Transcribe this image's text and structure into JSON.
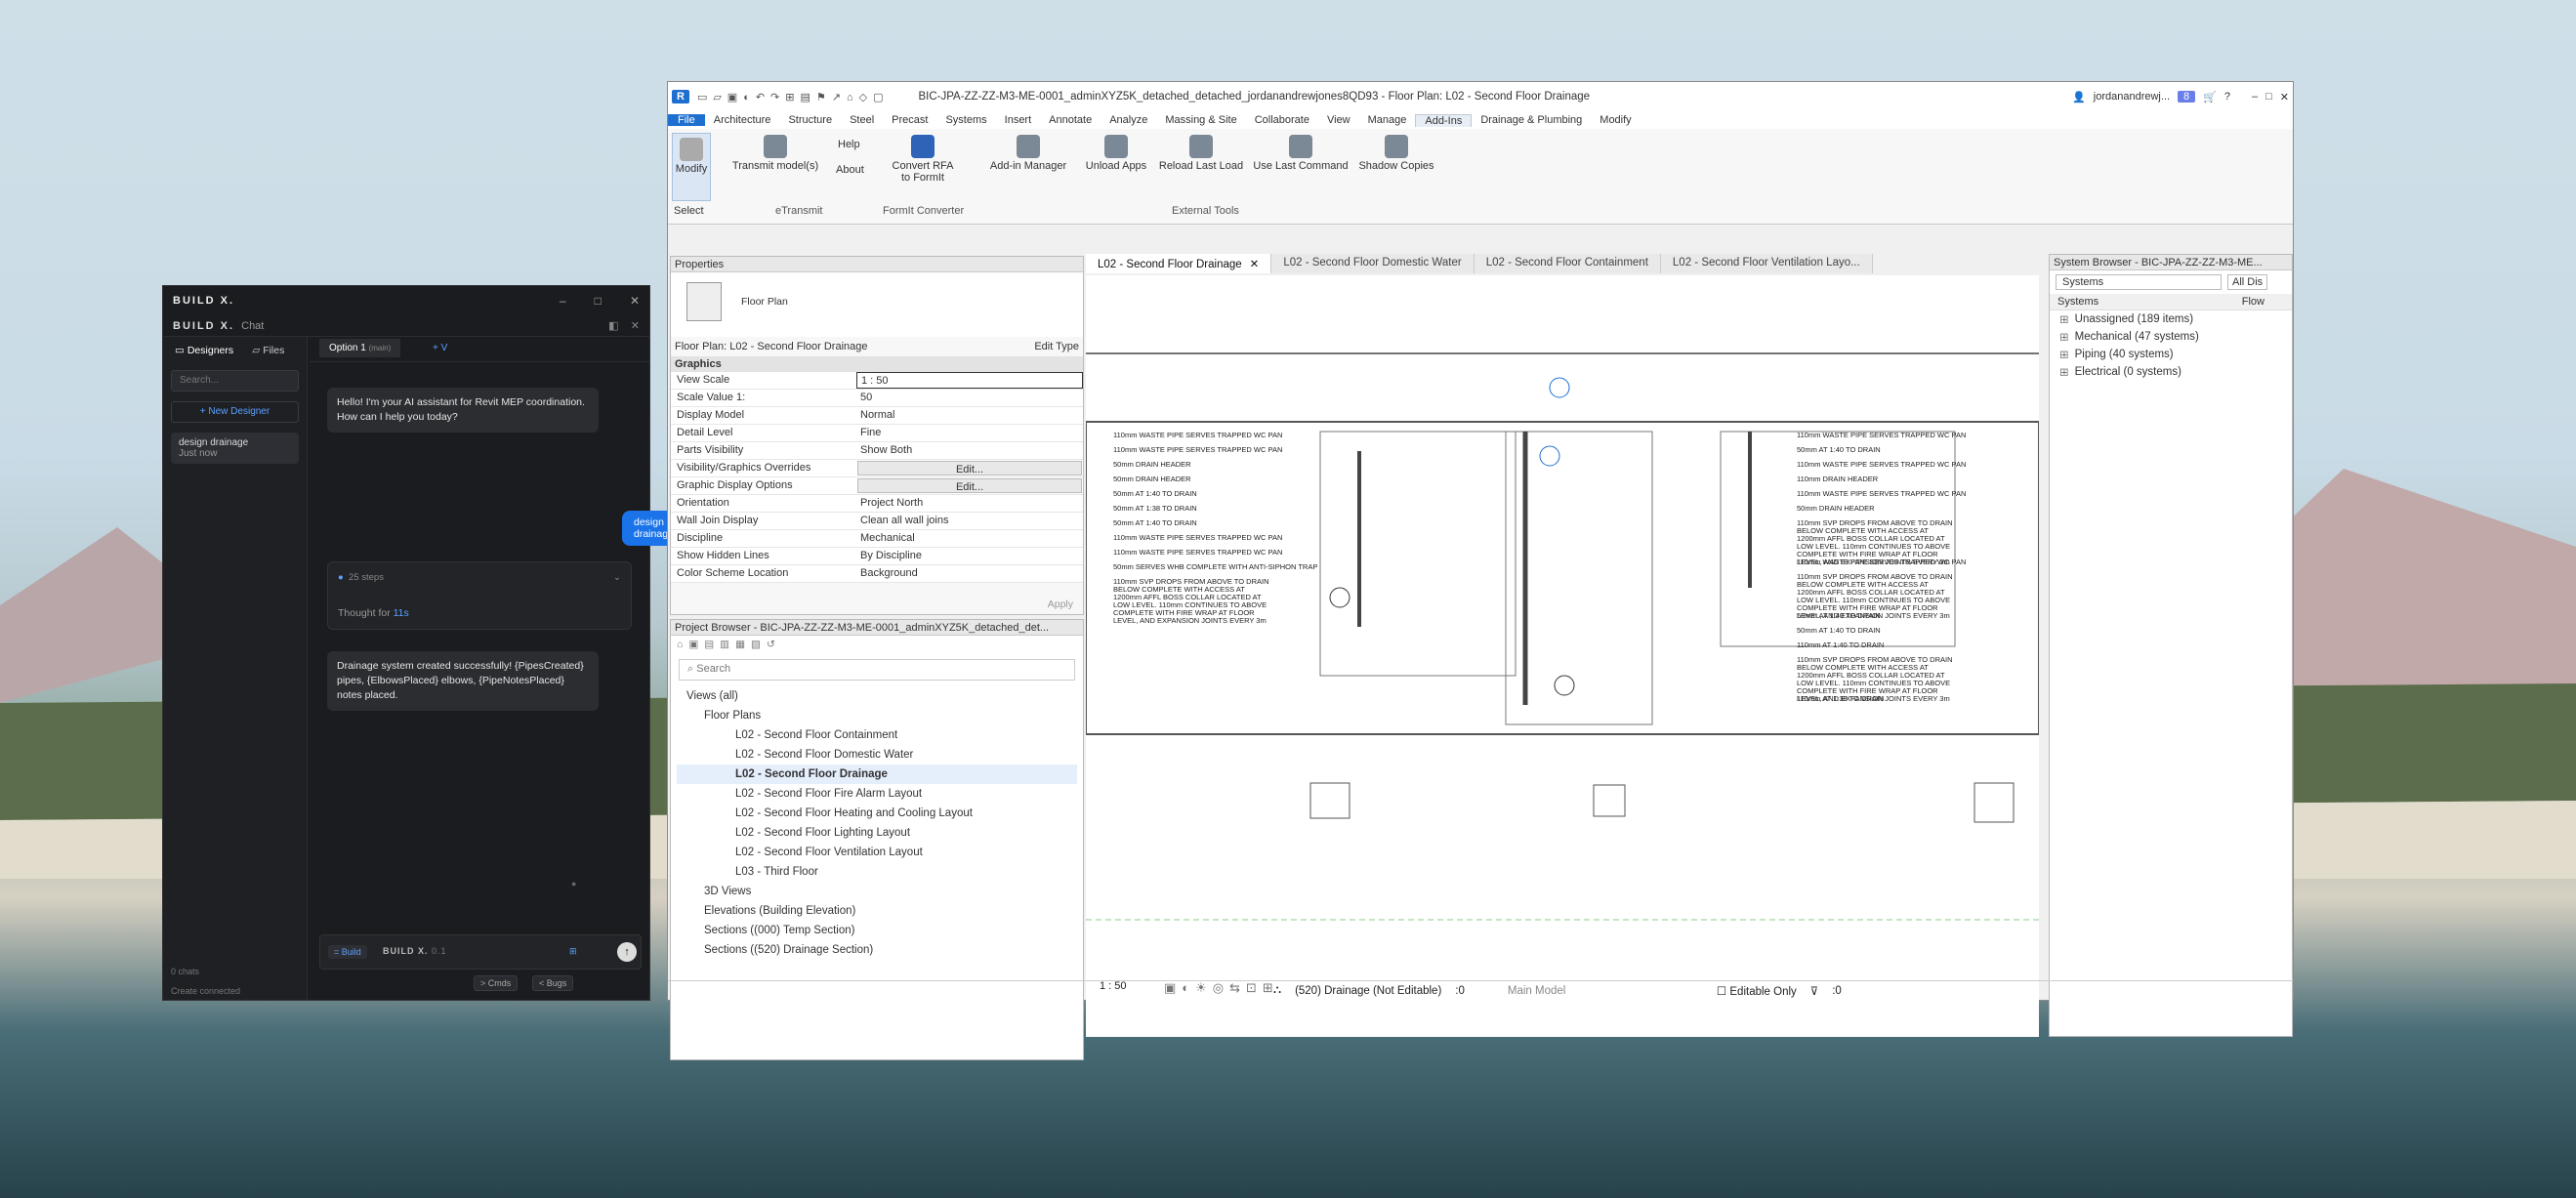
{
  "build_window": {
    "logo": "BUILD X.",
    "header_logo": "BUILD X.",
    "header_chat": "Chat",
    "min": "–",
    "max": "□",
    "close": "✕",
    "panel_close": "✕",
    "sidebar": {
      "tab_designers": "Designers",
      "tab_files": "Files",
      "search_placeholder": "Search...",
      "new_designer": "+ New Designer",
      "history": [
        {
          "title": "design drainage",
          "time": "Just now"
        }
      ],
      "chats_count": "0 chats",
      "status": "Create connected"
    },
    "main": {
      "tab_option": "Option 1",
      "tab_option_sub": "(main)",
      "tab_add": "+ V",
      "assistant_greeting": "Hello! I'm your AI assistant for Revit MEP coordination. How can I help you today?",
      "user_message": "design drainage",
      "steps": "25 steps",
      "thought_prefix": "Thought for ",
      "thought_time": "11s",
      "result_message": "Drainage system created successfully! {PipesCreated} pipes, {ElbowsPlaced} elbows, {PipeNotesPlaced} notes placed.",
      "mode_label": "= Build",
      "composer_logo": "BUILD X.",
      "composer_version": "0.1",
      "btn_cmds": "> Cmds",
      "btn_bugs": "< Bugs"
    }
  },
  "revit": {
    "title": "BIC-JPA-ZZ-ZZ-M3-ME-0001_adminXYZ5K_detached_detached_jordanandrewjones8QD93 - Floor Plan: L02 - Second Floor Drainage",
    "user": "jordanandrewj...",
    "badge": "8",
    "menu": [
      "File",
      "Architecture",
      "Structure",
      "Steel",
      "Precast",
      "Systems",
      "Insert",
      "Annotate",
      "Analyze",
      "Massing & Site",
      "Collaborate",
      "View",
      "Manage",
      "Add-Ins",
      "Drainage & Plumbing",
      "Modify"
    ],
    "active_menu": "Add-Ins",
    "ribbon": {
      "modify": "Modify",
      "select": "Select",
      "transmit": "Transmit model(s)",
      "help": "Help",
      "about": "About",
      "etransmit": "eTransmit",
      "convert": "Convert RFA to FormIt",
      "formit": "FormIt Converter",
      "addin": "Add-in Manager",
      "unload": "Unload Apps",
      "reload": "Reload Last Load",
      "uselast": "Use Last Command",
      "shadow": "Shadow Copies",
      "external": "External Tools"
    },
    "properties": {
      "title": "Properties",
      "type": "Floor Plan",
      "selector": "Floor Plan: L02 - Second Floor Drainage",
      "edit_type": "Edit Type",
      "section": "Graphics",
      "apply": "Apply",
      "rows": [
        [
          "View Scale",
          "1 : 50"
        ],
        [
          "Scale Value    1:",
          "50"
        ],
        [
          "Display Model",
          "Normal"
        ],
        [
          "Detail Level",
          "Fine"
        ],
        [
          "Parts Visibility",
          "Show Both"
        ],
        [
          "Visibility/Graphics Overrides",
          "Edit..."
        ],
        [
          "Graphic Display Options",
          "Edit..."
        ],
        [
          "Orientation",
          "Project North"
        ],
        [
          "Wall Join Display",
          "Clean all wall joins"
        ],
        [
          "Discipline",
          "Mechanical"
        ],
        [
          "Show Hidden Lines",
          "By Discipline"
        ],
        [
          "Color Scheme Location",
          "Background"
        ]
      ]
    },
    "project_browser": {
      "title": "Project Browser - BIC-JPA-ZZ-ZZ-M3-ME-0001_adminXYZ5K_detached_det...",
      "search": "Search",
      "root": "Views (all)",
      "floor_plans": "Floor Plans",
      "items": [
        "L02 - Second Floor Containment",
        "L02 - Second Floor Domestic Water",
        "L02 - Second Floor Drainage",
        "L02 - Second Floor Fire Alarm Layout",
        "L02 - Second Floor Heating and Cooling Layout",
        "L02 - Second Floor Lighting Layout",
        "L02 - Second Floor Ventilation Layout",
        "L03 - Third Floor"
      ],
      "selected": "L02 - Second Floor Drainage",
      "groups": [
        "3D Views",
        "Elevations (Building Elevation)",
        "Sections ((000) Temp Section)",
        "Sections ((520) Drainage Section)"
      ]
    },
    "tabs": [
      "L02 - Second Floor Drainage",
      "L02 - Second Floor Domestic Water",
      "L02 - Second Floor Containment",
      "L02 - Second Floor Ventilation Layo..."
    ],
    "system_browser": {
      "title": "System Browser - BIC-JPA-ZZ-ZZ-M3-ME...",
      "filter": "Systems",
      "filter2": "All Dis",
      "col1": "Systems",
      "col2": "Flow",
      "rows": [
        "Unassigned (189 items)",
        "Mechanical (47 systems)",
        "Piping (40 systems)",
        "Electrical (0 systems)"
      ]
    },
    "status": {
      "scale": "1 : 50",
      "workset": "(520) Drainage (Not Editable)",
      "zero": ":0",
      "model": "Main Model",
      "editable": "Editable Only",
      "filter": ":0"
    },
    "notes_left": [
      "110mm WASTE PIPE SERVES TRAPPED WC PAN",
      "110mm WASTE PIPE SERVES TRAPPED WC PAN",
      "50mm DRAIN HEADER",
      "50mm DRAIN HEADER",
      "50mm AT 1:40 TO DRAIN",
      "50mm AT 1:38 TO DRAIN",
      "50mm AT 1:40 TO DRAIN",
      "110mm WASTE PIPE SERVES TRAPPED WC PAN",
      "110mm WASTE PIPE SERVES TRAPPED WC PAN",
      "50mm SERVES WHB COMPLETE WITH ANTI-SIPHON TRAP",
      "110mm SVP DROPS FROM ABOVE TO DRAIN BELOW COMPLETE WITH ACCESS AT 1200mm AFFL BOSS COLLAR LOCATED AT LOW LEVEL. 110mm CONTINUES TO ABOVE COMPLETE WITH FIRE WRAP AT FLOOR LEVEL, AND EXPANSION JOINTS EVERY 3m"
    ],
    "notes_right": [
      "110mm WASTE PIPE SERVES TRAPPED WC PAN",
      "50mm AT 1:40 TO DRAIN",
      "110mm WASTE PIPE SERVES TRAPPED WC PAN",
      "110mm DRAIN HEADER",
      "110mm WASTE PIPE SERVES TRAPPED WC PAN",
      "50mm DRAIN HEADER",
      "110mm SVP DROPS FROM ABOVE TO DRAIN BELOW COMPLETE WITH ACCESS AT 1200mm AFFL BOSS COLLAR LOCATED AT LOW LEVEL. 110mm CONTINUES TO ABOVE COMPLETE WITH FIRE WRAP AT FLOOR LEVEL, AND EXPANSION JOINTS EVERY 3m",
      "110mm WASTE PIPE SERVES TRAPPED WC PAN",
      "110mm SVP DROPS FROM ABOVE TO DRAIN BELOW COMPLETE WITH ACCESS AT 1200mm AFFL BOSS COLLAR LOCATED AT LOW LEVEL. 110mm CONTINUES TO ABOVE COMPLETE WITH FIRE WRAP AT FLOOR LEVEL, AND EXPANSION JOINTS EVERY 3m",
      "50mm AT 1:40 TO DRAIN",
      "50mm AT 1:40 TO DRAIN",
      "110mm AT 1:40 TO DRAIN",
      "110mm SVP DROPS FROM ABOVE TO DRAIN BELOW COMPLETE WITH ACCESS AT 1200mm AFFL BOSS COLLAR LOCATED AT LOW LEVEL. 110mm CONTINUES TO ABOVE COMPLETE WITH FIRE WRAP AT FLOOR LEVEL, AND EXPANSION JOINTS EVERY 3m",
      "110mm AT 1:38 TO DRAIN"
    ]
  }
}
